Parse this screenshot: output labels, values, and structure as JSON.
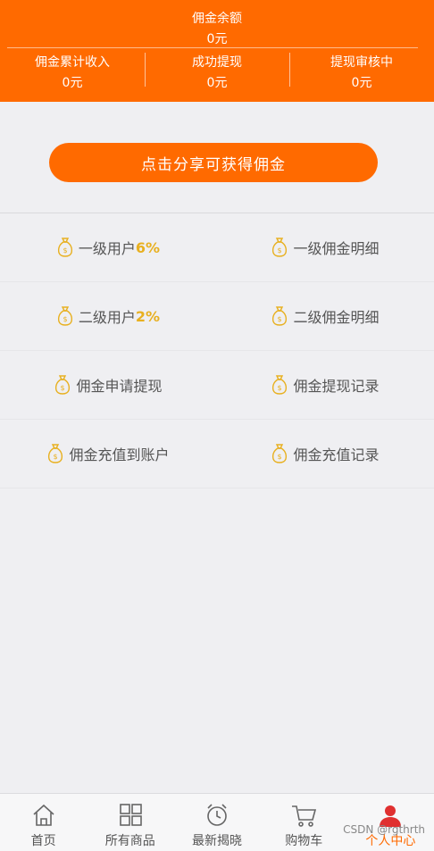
{
  "header": {
    "balance_label": "佣金余额",
    "balance_value": "0元",
    "stats": [
      {
        "label": "佣金累计收入",
        "value": "0元"
      },
      {
        "label": "成功提现",
        "value": "0元"
      },
      {
        "label": "提现审核中",
        "value": "0元"
      }
    ]
  },
  "share_button": "点击分享可获得佣金",
  "menu": {
    "level1_users": {
      "label": "一级用户",
      "percent": "6%"
    },
    "level1_detail": "一级佣金明细",
    "level2_users": {
      "label": "二级用户",
      "percent": "2%"
    },
    "level2_detail": "二级佣金明细",
    "apply_withdraw": "佣金申请提现",
    "withdraw_record": "佣金提现记录",
    "recharge_account": "佣金充值到账户",
    "recharge_record": "佣金充值记录"
  },
  "tabbar": {
    "home": "首页",
    "products": "所有商品",
    "latest": "最新揭晓",
    "cart": "购物车",
    "profile": "个人中心"
  },
  "watermark": "CSDN @rgthrth",
  "colors": {
    "accent": "#ff6a00",
    "icon_gold": "#e8b020"
  }
}
